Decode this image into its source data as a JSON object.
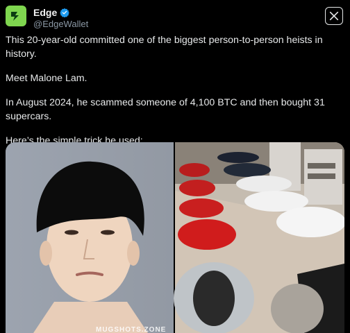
{
  "account": {
    "name": "Edge",
    "handle": "@EdgeWallet"
  },
  "post": {
    "paragraphs": [
      "This 20-year-old committed one of the biggest person-to-person heists in history.",
      "Meet Malone Lam.",
      "In August 2024, he scammed someone of 4,100 BTC and then bought 31 supercars.",
      "Here’s the simple trick he used:"
    ]
  },
  "media": {
    "watermark": "MUGSHOTS.ZONE",
    "images": [
      "mugshot-photo",
      "supercar-garage-photo"
    ]
  },
  "colors": {
    "background": "#000000",
    "text": "#e7e9ea",
    "secondary_text": "#8b98a5",
    "verified_badge": "#1d9bf0",
    "avatar_bg": "#7fd64f"
  },
  "icons": [
    "edge-logo-icon",
    "verified-badge-icon",
    "x-logo-icon"
  ]
}
